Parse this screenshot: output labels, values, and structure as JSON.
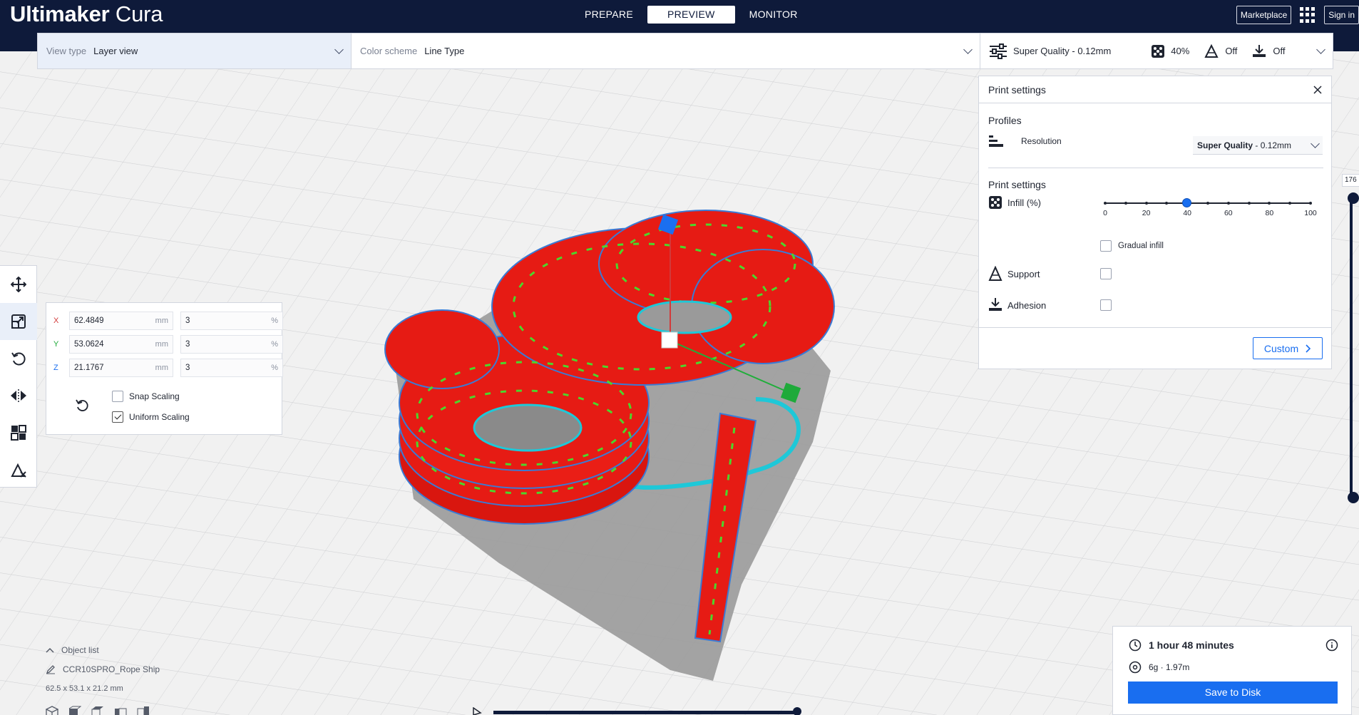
{
  "app": {
    "name_bold": "Ultimaker",
    "name_light": "Cura"
  },
  "stages": [
    {
      "label": "PREPARE"
    },
    {
      "label": "PREVIEW"
    },
    {
      "label": "MONITOR"
    }
  ],
  "header": {
    "marketplace_label": "Marketplace",
    "signin_label": "Sign in"
  },
  "settingsbar": {
    "view_type_label": "View type",
    "view_type_value": "Layer view",
    "color_scheme_label": "Color scheme",
    "color_scheme_value": "Line Type",
    "profile_summary": "Super Quality - 0.12mm",
    "infill_summary": "40%",
    "support_summary": "Off",
    "adhesion_summary": "Off"
  },
  "print_settings": {
    "title": "Print settings",
    "profiles_heading": "Profiles",
    "resolution_label": "Resolution",
    "resolution_value_bold": "Super Quality",
    "resolution_value_rest": " - 0.12mm",
    "settings_heading": "Print settings",
    "infill_label": "Infill (%)",
    "infill_value": 40,
    "infill_ticks": [
      "0",
      "20",
      "40",
      "60",
      "80",
      "100"
    ],
    "gradual_infill_label": "Gradual infill",
    "gradual_infill_checked": false,
    "support_label": "Support",
    "support_checked": false,
    "adhesion_label": "Adhesion",
    "adhesion_checked": false,
    "custom_button_label": "Custom"
  },
  "scale_tool": {
    "x": {
      "axis": "X",
      "mm": "62.4849",
      "mm_unit": "mm",
      "pct": "3",
      "pct_unit": "%"
    },
    "y": {
      "axis": "Y",
      "mm": "53.0624",
      "mm_unit": "mm",
      "pct": "3",
      "pct_unit": "%"
    },
    "z": {
      "axis": "Z",
      "mm": "21.1767",
      "mm_unit": "mm",
      "pct": "3",
      "pct_unit": "%"
    },
    "snap_scaling_label": "Snap Scaling",
    "snap_scaling_checked": false,
    "uniform_scaling_label": "Uniform Scaling",
    "uniform_scaling_checked": true
  },
  "object_list": {
    "title": "Object list",
    "object_name": "CCR10SPRO_Rope Ship",
    "dimensions": "62.5 x 53.1 x 21.2 mm"
  },
  "layer_slider": {
    "value": "176"
  },
  "estimate": {
    "time": "1 hour 48 minutes",
    "material": "6g · 1.97m",
    "save_label": "Save to Disk"
  },
  "colors": {
    "header_bg": "#0e1a3a",
    "accent": "#196ef0",
    "model_red": "#e61b14",
    "infill_green": "#4cd62c",
    "skirt_cyan": "#1ec8d8",
    "shadow": "#9a9a9a"
  }
}
